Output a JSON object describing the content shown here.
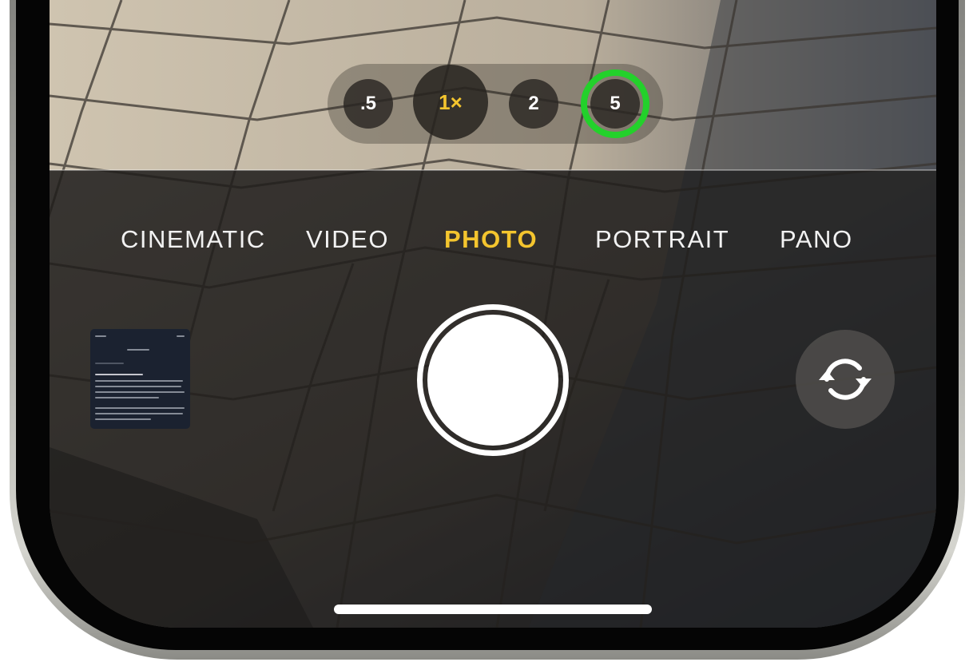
{
  "zoom": {
    "options": [
      ".5",
      "1×",
      "2",
      "5"
    ],
    "selected": "1×",
    "highlighted": "5",
    "highlight_color": "#23d12b"
  },
  "modes": {
    "items": [
      "CINEMATIC",
      "VIDEO",
      "PHOTO",
      "PORTRAIT",
      "PANO"
    ],
    "active": "PHOTO",
    "active_color": "#f4c52e"
  },
  "controls": {
    "shutter": "shutter-button",
    "thumbnail": "last-photo-thumbnail",
    "flip_camera_icon": "camera-flip-icon"
  }
}
